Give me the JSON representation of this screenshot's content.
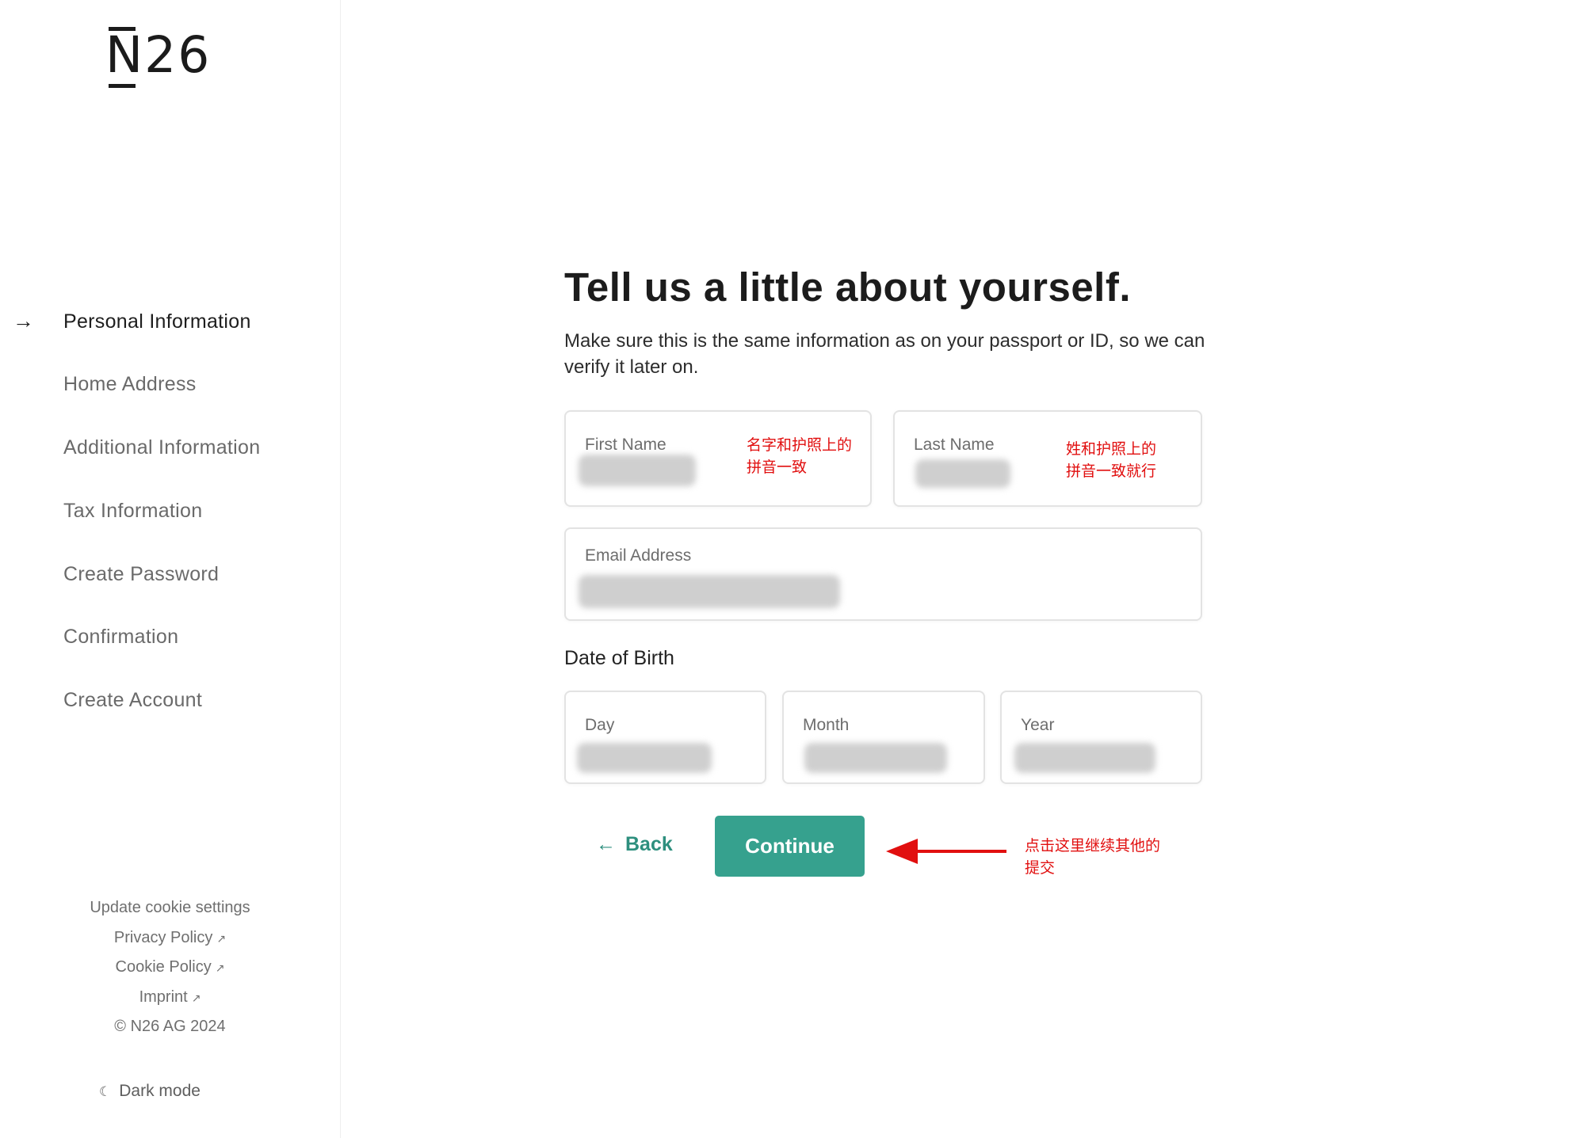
{
  "sidebar": {
    "logo": {
      "letter": "N",
      "digits": "26"
    },
    "steps": [
      {
        "label": "Personal Information",
        "active": true
      },
      {
        "label": "Home Address"
      },
      {
        "label": "Additional Information"
      },
      {
        "label": "Tax Information"
      },
      {
        "label": "Create Password"
      },
      {
        "label": "Confirmation"
      },
      {
        "label": "Create Account"
      }
    ],
    "footer": {
      "cookie_settings": "Update cookie settings",
      "privacy_policy": "Privacy Policy",
      "cookie_policy": "Cookie Policy",
      "imprint": "Imprint",
      "external_glyph": "↗",
      "copyright": "© N26 AG 2024",
      "dark_mode": "Dark mode"
    }
  },
  "main": {
    "title": "Tell us a little about yourself.",
    "subtitle": "Make sure this is the same information as on your passport or ID, so we can verify it later on.",
    "fields": {
      "first_name": "First Name",
      "last_name": "Last Name",
      "email": "Email Address",
      "dob_label": "Date of Birth",
      "day": "Day",
      "month": "Month",
      "year": "Year"
    },
    "buttons": {
      "back": "Back",
      "continue": "Continue"
    }
  },
  "annotations": {
    "first_name_note": [
      "名字和护照上的",
      "拼音一致"
    ],
    "last_name_note": [
      "姓和护照上的",
      "拼音一致就行"
    ],
    "continue_note": [
      "点击这里继续其他的",
      "提交"
    ],
    "color": "#e10f0f"
  },
  "colors": {
    "accent": "#36a18e",
    "back_link": "#2e8f7e"
  },
  "icons": {
    "step_arrow": "arrow-right-icon",
    "back": "arrow-left-icon",
    "dark_mode": "moon-icon",
    "external": "external-link-icon"
  }
}
